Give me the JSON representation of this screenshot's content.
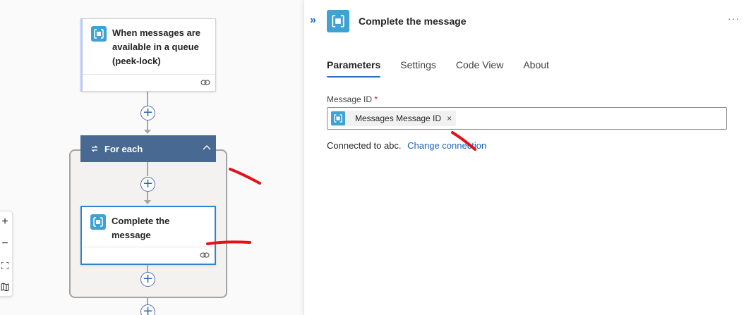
{
  "workflow": {
    "trigger": {
      "title": "When messages are available in a queue (peek-lock)"
    },
    "foreach": {
      "label": "For each"
    },
    "action": {
      "title": "Complete the message"
    }
  },
  "zoom": {
    "zoom_in": "+",
    "zoom_out": "−"
  },
  "panel": {
    "title": "Complete the message",
    "tabs": [
      {
        "label": "Parameters",
        "active": true
      },
      {
        "label": "Settings",
        "active": false
      },
      {
        "label": "Code View",
        "active": false
      },
      {
        "label": "About",
        "active": false
      }
    ],
    "field": {
      "label": "Message ID",
      "required_mark": "*",
      "token_label": "Messages Message ID",
      "token_remove": "×"
    },
    "connection": {
      "text": "Connected to abc.",
      "link": "Change connection"
    },
    "more": "···",
    "collapse": "»"
  },
  "colors": {
    "accent": "#2f82cf",
    "icon_bg": "#3fa2d4",
    "foreach_header": "#486991",
    "annotation_red": "#e0131a"
  },
  "icons": [
    "queue-message-icon",
    "link-icon",
    "loop-icon",
    "chevron-up-icon",
    "plus-icon",
    "fit-screen-icon",
    "minimap-icon",
    "collapse-panel-icon",
    "more-options-icon",
    "close-icon"
  ]
}
